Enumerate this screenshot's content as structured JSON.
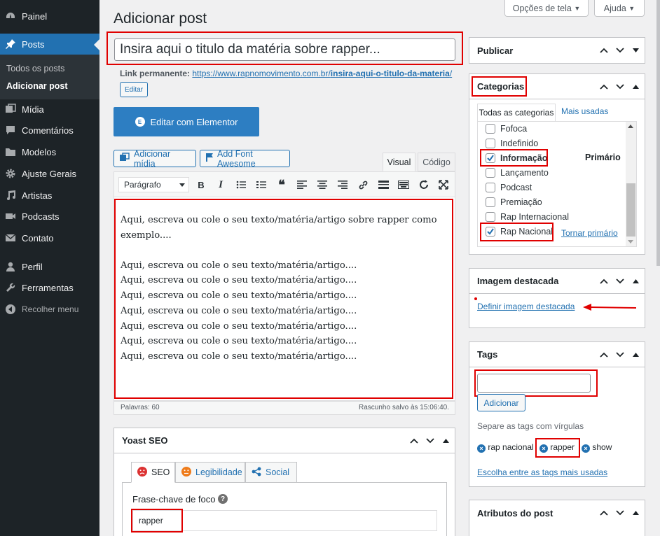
{
  "sidebar": {
    "items": [
      {
        "label": "Painel",
        "icon": "dashboard-icon"
      },
      {
        "label": "Posts",
        "icon": "pin-icon"
      },
      {
        "label": "Mídia",
        "icon": "media-icon"
      },
      {
        "label": "Comentários",
        "icon": "comment-icon"
      },
      {
        "label": "Modelos",
        "icon": "folder-icon"
      },
      {
        "label": "Ajuste Gerais",
        "icon": "gear-icon"
      },
      {
        "label": "Artistas",
        "icon": "music-icon"
      },
      {
        "label": "Podcasts",
        "icon": "video-icon"
      },
      {
        "label": "Contato",
        "icon": "mail-icon"
      },
      {
        "label": "Perfil",
        "icon": "user-icon"
      },
      {
        "label": "Ferramentas",
        "icon": "wrench-icon"
      },
      {
        "label": "Recolher menu",
        "icon": "collapse-icon"
      }
    ],
    "submenu": [
      "Todos os posts",
      "Adicionar post"
    ]
  },
  "top": {
    "screen_options": "Opções de tela",
    "help": "Ajuda"
  },
  "page": {
    "title": "Adicionar post"
  },
  "post": {
    "title_value": "Insira aqui o titulo da matéria sobre rapper...",
    "permalink_label": "Link permanente:",
    "permalink_base": "https://www.rapnomovimento.com.br/",
    "permalink_slug": "insira-aqui-o-titulo-da-materia",
    "permalink_suffix": "/",
    "edit_label": "Editar",
    "elementor_label": "Editar com Elementor",
    "elementor_logo": "E"
  },
  "editor": {
    "add_media": "Adicionar mídia",
    "add_font_awesome": "Add Font Awesome",
    "tab_visual": "Visual",
    "tab_code": "Código",
    "format": "Parágrafo",
    "lines": [
      "Aqui, escreva ou cole o seu texto/matéria/artigo sobre rapper como",
      "exemplo....",
      "Aqui, escreva ou cole o seu texto/matéria/artigo....",
      "Aqui, escreva ou cole o seu texto/matéria/artigo....",
      "Aqui, escreva ou cole o seu texto/matéria/artigo....",
      "Aqui, escreva ou cole o seu texto/matéria/artigo....",
      "Aqui, escreva ou cole o seu texto/matéria/artigo....",
      "Aqui, escreva ou cole o seu texto/matéria/artigo....",
      "Aqui, escreva ou cole o seu texto/matéria/artigo...."
    ],
    "word_count": "Palavras: 60",
    "draft_saved": "Rascunho salvo às 15:06:40."
  },
  "yoast": {
    "title": "Yoast SEO",
    "tabs": [
      "SEO",
      "Legibilidade",
      "Social"
    ],
    "focus_label": "Frase-chave de foco",
    "focus_value": "rapper",
    "help": "?"
  },
  "publish": {
    "title": "Publicar"
  },
  "categories": {
    "title": "Categorias",
    "tab_all": "Todas as categorias",
    "tab_popular": "Mais usadas",
    "items": [
      {
        "label": "Fofoca",
        "checked": false
      },
      {
        "label": "Indefinido",
        "checked": false
      },
      {
        "label": "Informação",
        "checked": true
      },
      {
        "label": "Lançamento",
        "checked": false
      },
      {
        "label": "Podcast",
        "checked": false
      },
      {
        "label": "Premiação",
        "checked": false
      },
      {
        "label": "Rap Internacional",
        "checked": false
      },
      {
        "label": "Rap Nacional",
        "checked": true
      }
    ],
    "primary_label": "Primário",
    "make_primary": "Tornar primário"
  },
  "featured": {
    "title": "Imagem destacada",
    "set_link": "Definir imagem destacada"
  },
  "tags": {
    "title": "Tags",
    "add_button": "Adicionar",
    "hint": "Separe as tags com vírgulas",
    "items": [
      "rap nacional",
      "rapper",
      "show"
    ],
    "choose_link": "Escolha entre as tags mais usadas"
  },
  "attributes": {
    "title": "Atributos do post"
  },
  "colors": {
    "accent": "#2271b1",
    "highlight": "#e00000",
    "sidebar": "#1d2327"
  }
}
